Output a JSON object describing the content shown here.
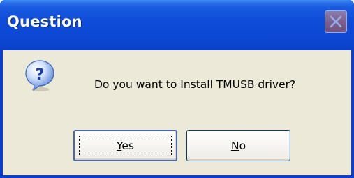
{
  "dialog": {
    "title": "Question",
    "message": "Do you want to Install TMUSB driver?",
    "icon": "question-icon",
    "close_icon": "close-icon"
  },
  "buttons": {
    "yes": {
      "mnemonic": "Y",
      "rest": "es"
    },
    "no": {
      "mnemonic": "N",
      "rest": "o"
    }
  },
  "colors": {
    "titlebar": "#0a44cc",
    "body": "#ece9d8",
    "button_border": "#003c74"
  }
}
